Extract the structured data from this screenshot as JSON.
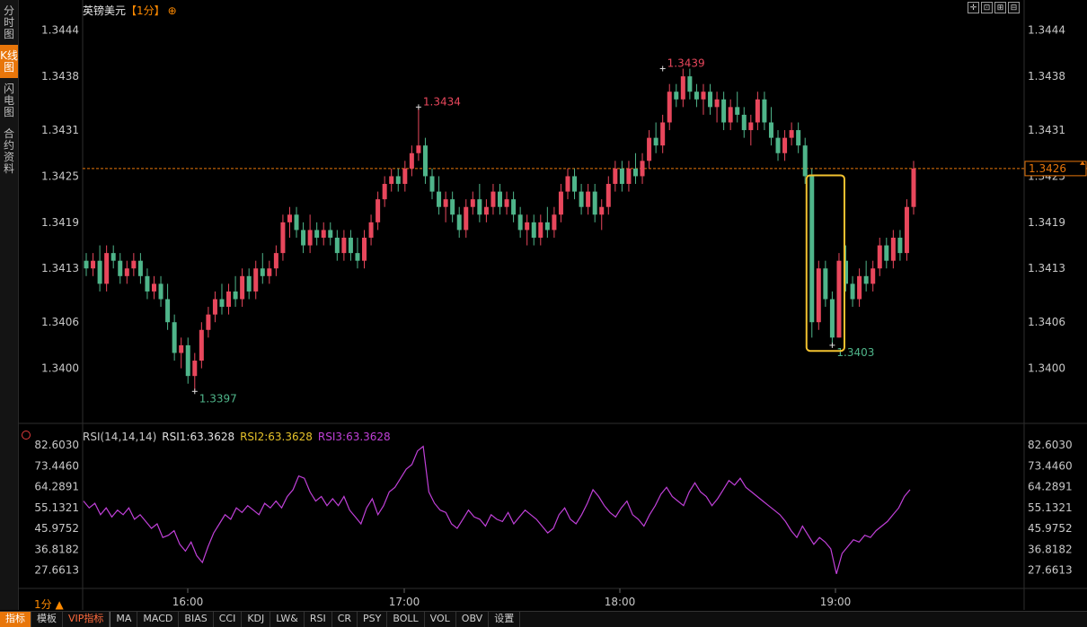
{
  "sidebar": {
    "tabs": [
      {
        "label": "分时图",
        "active": false
      },
      {
        "label": "K线图",
        "active": true
      },
      {
        "label": "闪电图",
        "active": false
      },
      {
        "label": "合约资料",
        "active": false
      }
    ]
  },
  "header": {
    "symbol": "英镑美元",
    "period": "【1分】",
    "add_icon": "⊕",
    "tool_icons": [
      "crosshair-icon",
      "expand-icon",
      "reset-icon",
      "fullscreen-icon"
    ],
    "tool_glyphs": [
      "✛",
      "⊡",
      "⊞",
      "⊟"
    ]
  },
  "price_axis": {
    "labels": [
      "1.3444",
      "1.3438",
      "1.3431",
      "1.3425",
      "1.3419",
      "1.3413",
      "1.3406",
      "1.3400"
    ],
    "current": "1.3426"
  },
  "annotations": {
    "high1": "1.3434",
    "high2": "1.3439",
    "low1": "1.3397",
    "low2": "1.3403"
  },
  "rsi": {
    "params": "RSI(14,14,14)",
    "rsi1": "RSI1:63.3628",
    "rsi2": "RSI2:63.3628",
    "rsi3": "RSI3:63.3628",
    "axis_labels": [
      "82.6030",
      "73.4460",
      "64.2891",
      "55.1321",
      "45.9752",
      "36.8182",
      "27.6613"
    ]
  },
  "time_axis": [
    "16:00",
    "17:00",
    "18:00",
    "19:00"
  ],
  "bottom_period": "1分 ▲",
  "bottom_tabs": [
    "指标",
    "模板",
    "VIP指标",
    "MA",
    "MACD",
    "BIAS",
    "CCI",
    "KDJ",
    "LW&",
    "RSI",
    "CR",
    "PSY",
    "BOLL",
    "VOL",
    "OBV",
    "设置"
  ],
  "colors": {
    "up": "#e8475c",
    "down": "#4fb58a",
    "rsi": "#c040d8",
    "accent": "#e8760a"
  },
  "chart_data": {
    "type": "candlestick",
    "x_labels": [
      "16:00",
      "17:00",
      "18:00",
      "19:00"
    ],
    "ylim": [
      1.3394,
      1.3447
    ],
    "current_price": 1.3426,
    "candles": [
      [
        1.3414,
        1.3415,
        1.3412,
        1.3413
      ],
      [
        1.3413,
        1.3415,
        1.3412,
        1.3414
      ],
      [
        1.3414,
        1.3416,
        1.341,
        1.3411
      ],
      [
        1.3411,
        1.3416,
        1.341,
        1.3415
      ],
      [
        1.3415,
        1.3416,
        1.3413,
        1.3414
      ],
      [
        1.3414,
        1.3415,
        1.3411,
        1.3412
      ],
      [
        1.3412,
        1.3414,
        1.3411,
        1.3413
      ],
      [
        1.3413,
        1.3415,
        1.3412,
        1.3414
      ],
      [
        1.3414,
        1.3415,
        1.3411,
        1.3412
      ],
      [
        1.3412,
        1.3413,
        1.3409,
        1.341
      ],
      [
        1.341,
        1.3412,
        1.3409,
        1.3411
      ],
      [
        1.3411,
        1.3412,
        1.3408,
        1.3409
      ],
      [
        1.3409,
        1.3411,
        1.3405,
        1.3406
      ],
      [
        1.3406,
        1.3407,
        1.3401,
        1.3402
      ],
      [
        1.3402,
        1.3404,
        1.34,
        1.3403
      ],
      [
        1.3403,
        1.3404,
        1.3398,
        1.3399
      ],
      [
        1.3399,
        1.3402,
        1.3397,
        1.3401
      ],
      [
        1.3401,
        1.3406,
        1.34,
        1.3405
      ],
      [
        1.3405,
        1.3408,
        1.3404,
        1.3407
      ],
      [
        1.3407,
        1.341,
        1.3406,
        1.3409
      ],
      [
        1.3409,
        1.3411,
        1.3407,
        1.3408
      ],
      [
        1.3408,
        1.3411,
        1.3407,
        1.341
      ],
      [
        1.341,
        1.3412,
        1.3408,
        1.3409
      ],
      [
        1.3409,
        1.3413,
        1.3408,
        1.3412
      ],
      [
        1.3412,
        1.3413,
        1.3409,
        1.341
      ],
      [
        1.341,
        1.3414,
        1.3409,
        1.3413
      ],
      [
        1.3413,
        1.3415,
        1.3411,
        1.3412
      ],
      [
        1.3412,
        1.3414,
        1.3411,
        1.3413
      ],
      [
        1.3413,
        1.3416,
        1.3412,
        1.3415
      ],
      [
        1.3415,
        1.342,
        1.3414,
        1.3419
      ],
      [
        1.3419,
        1.3421,
        1.3417,
        1.342
      ],
      [
        1.342,
        1.3421,
        1.3417,
        1.3418
      ],
      [
        1.3418,
        1.3419,
        1.3415,
        1.3416
      ],
      [
        1.3416,
        1.342,
        1.3415,
        1.3418
      ],
      [
        1.3418,
        1.3419,
        1.3416,
        1.3417
      ],
      [
        1.3417,
        1.3419,
        1.3416,
        1.3418
      ],
      [
        1.3418,
        1.3419,
        1.3416,
        1.3417
      ],
      [
        1.3417,
        1.3418,
        1.3414,
        1.3415
      ],
      [
        1.3415,
        1.3418,
        1.3414,
        1.3417
      ],
      [
        1.3417,
        1.3418,
        1.3414,
        1.3415
      ],
      [
        1.3415,
        1.3417,
        1.3413,
        1.3414
      ],
      [
        1.3414,
        1.3418,
        1.3413,
        1.3417
      ],
      [
        1.3417,
        1.342,
        1.3416,
        1.3419
      ],
      [
        1.3419,
        1.3423,
        1.3418,
        1.3422
      ],
      [
        1.3422,
        1.3425,
        1.3421,
        1.3424
      ],
      [
        1.3424,
        1.3426,
        1.3423,
        1.3425
      ],
      [
        1.3425,
        1.3426,
        1.3423,
        1.3424
      ],
      [
        1.3424,
        1.3427,
        1.3423,
        1.3426
      ],
      [
        1.3426,
        1.3429,
        1.3425,
        1.3428
      ],
      [
        1.3428,
        1.3434,
        1.3427,
        1.3429
      ],
      [
        1.3429,
        1.343,
        1.3424,
        1.3425
      ],
      [
        1.3425,
        1.3426,
        1.3422,
        1.3423
      ],
      [
        1.3423,
        1.3425,
        1.342,
        1.3421
      ],
      [
        1.3421,
        1.3423,
        1.3419,
        1.3422
      ],
      [
        1.3422,
        1.3423,
        1.3419,
        1.342
      ],
      [
        1.342,
        1.3421,
        1.3417,
        1.3418
      ],
      [
        1.3418,
        1.3422,
        1.3417,
        1.3421
      ],
      [
        1.3421,
        1.3423,
        1.342,
        1.3422
      ],
      [
        1.3422,
        1.3424,
        1.3419,
        1.342
      ],
      [
        1.342,
        1.3422,
        1.3419,
        1.3421
      ],
      [
        1.3421,
        1.3424,
        1.342,
        1.3423
      ],
      [
        1.3423,
        1.3424,
        1.342,
        1.3421
      ],
      [
        1.3421,
        1.3423,
        1.342,
        1.3422
      ],
      [
        1.3422,
        1.3423,
        1.3419,
        1.342
      ],
      [
        1.342,
        1.3421,
        1.3417,
        1.3418
      ],
      [
        1.3418,
        1.342,
        1.3416,
        1.3419
      ],
      [
        1.3419,
        1.342,
        1.3416,
        1.3417
      ],
      [
        1.3417,
        1.342,
        1.3416,
        1.3419
      ],
      [
        1.3419,
        1.3421,
        1.3417,
        1.3418
      ],
      [
        1.3418,
        1.3421,
        1.3417,
        1.342
      ],
      [
        1.342,
        1.3424,
        1.3419,
        1.3423
      ],
      [
        1.3423,
        1.3426,
        1.3422,
        1.3425
      ],
      [
        1.3425,
        1.3426,
        1.3422,
        1.3423
      ],
      [
        1.3423,
        1.3424,
        1.342,
        1.3421
      ],
      [
        1.3421,
        1.3424,
        1.342,
        1.3423
      ],
      [
        1.3423,
        1.3424,
        1.3419,
        1.342
      ],
      [
        1.342,
        1.3422,
        1.3418,
        1.3421
      ],
      [
        1.3421,
        1.3425,
        1.342,
        1.3424
      ],
      [
        1.3424,
        1.3427,
        1.3423,
        1.3426
      ],
      [
        1.3426,
        1.3427,
        1.3423,
        1.3424
      ],
      [
        1.3424,
        1.3427,
        1.3423,
        1.3426
      ],
      [
        1.3426,
        1.3428,
        1.3424,
        1.3425
      ],
      [
        1.3425,
        1.3428,
        1.3424,
        1.3427
      ],
      [
        1.3427,
        1.3431,
        1.3426,
        1.343
      ],
      [
        1.343,
        1.3432,
        1.3428,
        1.3429
      ],
      [
        1.3429,
        1.3433,
        1.3428,
        1.3432
      ],
      [
        1.3432,
        1.3437,
        1.3431,
        1.3436
      ],
      [
        1.3436,
        1.3437,
        1.3434,
        1.3435
      ],
      [
        1.3435,
        1.3439,
        1.3434,
        1.3438
      ],
      [
        1.3438,
        1.3439,
        1.3435,
        1.3436
      ],
      [
        1.3436,
        1.3437,
        1.3434,
        1.3435
      ],
      [
        1.3435,
        1.3437,
        1.3433,
        1.3436
      ],
      [
        1.3436,
        1.3437,
        1.3433,
        1.3434
      ],
      [
        1.3434,
        1.3436,
        1.3432,
        1.3435
      ],
      [
        1.3435,
        1.3436,
        1.3431,
        1.3432
      ],
      [
        1.3432,
        1.3435,
        1.3431,
        1.3434
      ],
      [
        1.3434,
        1.3436,
        1.3432,
        1.3433
      ],
      [
        1.3433,
        1.3434,
        1.343,
        1.3431
      ],
      [
        1.3431,
        1.3433,
        1.3429,
        1.3432
      ],
      [
        1.3432,
        1.3436,
        1.3431,
        1.3435
      ],
      [
        1.3435,
        1.3436,
        1.3431,
        1.3432
      ],
      [
        1.3432,
        1.3434,
        1.3429,
        1.343
      ],
      [
        1.343,
        1.3431,
        1.3427,
        1.3428
      ],
      [
        1.3428,
        1.3431,
        1.3427,
        1.343
      ],
      [
        1.343,
        1.3432,
        1.3429,
        1.3431
      ],
      [
        1.3431,
        1.3432,
        1.3428,
        1.3429
      ],
      [
        1.3429,
        1.343,
        1.3424,
        1.3425
      ],
      [
        1.3425,
        1.3426,
        1.3404,
        1.3406
      ],
      [
        1.3406,
        1.3414,
        1.3405,
        1.3413
      ],
      [
        1.3413,
        1.3414,
        1.3408,
        1.3409
      ],
      [
        1.3409,
        1.341,
        1.3403,
        1.3404
      ],
      [
        1.3404,
        1.3415,
        1.3404,
        1.3414
      ],
      [
        1.3414,
        1.3416,
        1.341,
        1.3411
      ],
      [
        1.3411,
        1.3412,
        1.3408,
        1.3409
      ],
      [
        1.3409,
        1.3413,
        1.3408,
        1.3412
      ],
      [
        1.3412,
        1.3414,
        1.341,
        1.3411
      ],
      [
        1.3411,
        1.3414,
        1.341,
        1.3413
      ],
      [
        1.3413,
        1.3417,
        1.3412,
        1.3416
      ],
      [
        1.3416,
        1.3417,
        1.3413,
        1.3414
      ],
      [
        1.3414,
        1.3418,
        1.3413,
        1.3417
      ],
      [
        1.3417,
        1.3418,
        1.3414,
        1.3415
      ],
      [
        1.3415,
        1.3422,
        1.3414,
        1.3421
      ],
      [
        1.3421,
        1.3427,
        1.342,
        1.3426
      ]
    ],
    "rsi": {
      "ylim": [
        22,
        85
      ],
      "values": [
        58,
        55,
        57,
        52,
        55,
        51,
        54,
        52,
        55,
        50,
        52,
        49,
        46,
        48,
        42,
        43,
        45,
        39,
        36,
        40,
        34,
        31,
        38,
        44,
        48,
        52,
        50,
        55,
        53,
        56,
        54,
        52,
        57,
        55,
        58,
        55,
        60,
        63,
        69,
        68,
        62,
        58,
        60,
        56,
        59,
        56,
        60,
        54,
        51,
        48,
        55,
        59,
        52,
        56,
        62,
        64,
        68,
        72,
        74,
        80,
        82,
        62,
        57,
        54,
        53,
        48,
        46,
        50,
        54,
        51,
        50,
        47,
        52,
        50,
        49,
        53,
        48,
        51,
        54,
        52,
        50,
        47,
        44,
        46,
        52,
        55,
        50,
        48,
        52,
        57,
        63,
        60,
        56,
        53,
        51,
        55,
        58,
        52,
        50,
        47,
        52,
        56,
        61,
        64,
        60,
        58,
        56,
        62,
        66,
        62,
        60,
        56,
        59,
        63,
        67,
        65,
        68,
        64,
        62,
        60,
        58,
        56,
        54,
        52,
        49,
        45,
        42,
        47,
        43,
        39,
        42,
        40,
        37,
        26,
        35,
        38,
        41,
        40,
        43,
        42,
        45,
        47,
        49,
        52,
        55,
        60,
        63
      ]
    }
  }
}
